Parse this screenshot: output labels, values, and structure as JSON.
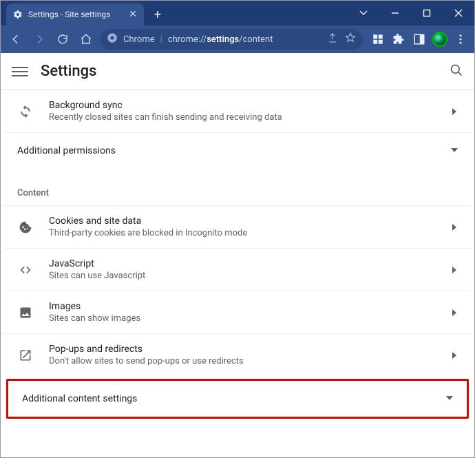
{
  "window": {
    "tab_title": "Settings - Site settings"
  },
  "toolbar": {
    "url_prefix": "Chrome",
    "url_part1": "chrome://",
    "url_bold": "settings",
    "url_part2": "/content"
  },
  "header": {
    "title": "Settings"
  },
  "rows": {
    "bgsync": {
      "title": "Background sync",
      "sub": "Recently closed sites can finish sending and receiving data"
    },
    "addperm": {
      "title": "Additional permissions"
    },
    "section_content": "Content",
    "cookies": {
      "title": "Cookies and site data",
      "sub": "Third-party cookies are blocked in Incognito mode"
    },
    "js": {
      "title": "JavaScript",
      "sub": "Sites can use Javascript"
    },
    "images": {
      "title": "Images",
      "sub": "Sites can show images"
    },
    "popups": {
      "title": "Pop-ups and redirects",
      "sub": "Don't allow sites to send pop-ups or use redirects"
    },
    "addcontent": {
      "title": "Additional content settings"
    }
  }
}
